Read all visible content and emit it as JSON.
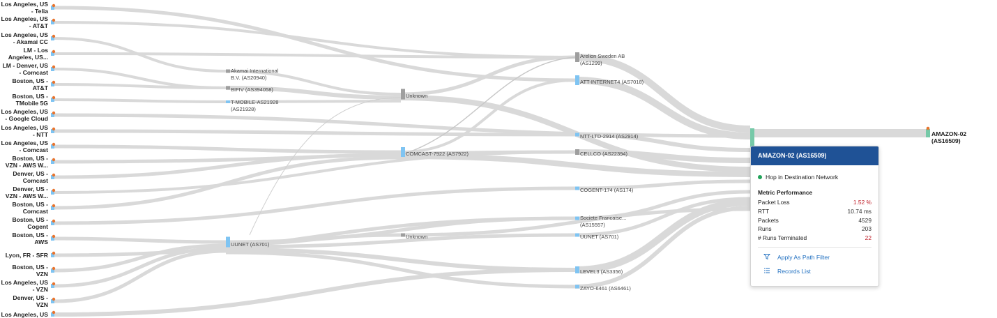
{
  "colors": {
    "flow": "#d9d9d9",
    "flow_thin": "#cfcfcf",
    "node_blue": "#7fc4f2",
    "node_gray": "#9e9e9e",
    "dest_green": "#76c9a8",
    "header_blue": "#1f5296",
    "loss_red": "#c0222c",
    "warn_orange": "#e8742e",
    "link_blue": "#1f6fc0"
  },
  "sources": [
    {
      "id": "s0",
      "label": "Los Angeles, US\n- Telia"
    },
    {
      "id": "s1",
      "label": "Los Angeles, US\n- AT&T"
    },
    {
      "id": "s2",
      "label": "Los Angeles, US\n- Akamai CC"
    },
    {
      "id": "s3",
      "label": "LM - Los\nAngeles, US..."
    },
    {
      "id": "s4",
      "label": "LM - Denver, US\n- Comcast"
    },
    {
      "id": "s5",
      "label": "Boston, US -\nAT&T"
    },
    {
      "id": "s6",
      "label": "Boston, US -\nTMobile 5G"
    },
    {
      "id": "s7",
      "label": "Los Angeles, US\n- Google Cloud"
    },
    {
      "id": "s8",
      "label": "Los Angeles, US\n- NTT"
    },
    {
      "id": "s9",
      "label": "Los Angeles, US\n- Comcast"
    },
    {
      "id": "s10",
      "label": "Boston, US -\nVZN - AWS W..."
    },
    {
      "id": "s11",
      "label": "Denver, US -\nComcast"
    },
    {
      "id": "s12",
      "label": "Denver, US -\nVZN - AWS W..."
    },
    {
      "id": "s13",
      "label": "Boston, US -\nComcast"
    },
    {
      "id": "s14",
      "label": "Boston, US -\nCogent"
    },
    {
      "id": "s15",
      "label": "Boston, US -\nAWS"
    },
    {
      "id": "s16",
      "label": "Lyon, FR - SFR"
    },
    {
      "id": "s17",
      "label": "Boston, US -\nVZN"
    },
    {
      "id": "s18",
      "label": "Los Angeles, US\n- VZN"
    },
    {
      "id": "s19",
      "label": "Denver, US -\nVZN"
    },
    {
      "id": "s20",
      "label": "Los Angeles, US"
    }
  ],
  "hop1_nodes": [
    {
      "id": "akamai",
      "label1": "Akamai International",
      "label2": "B.V. (AS20940)",
      "color": "gray"
    },
    {
      "id": "bifiv",
      "label1": "BIFIV (AS394058)",
      "label2": "",
      "color": "gray"
    },
    {
      "id": "tmobile",
      "label1": "T-MOBILE-AS21928",
      "label2": "(AS21928)",
      "color": "blue"
    },
    {
      "id": "uunet1",
      "label1": "UUNET (AS701)",
      "label2": "",
      "color": "blue"
    }
  ],
  "hop2_nodes": [
    {
      "id": "unknown1",
      "label1": "Unknown",
      "label2": "",
      "color": "gray"
    },
    {
      "id": "comcast",
      "label1": "COMCAST-7922 (AS7922)",
      "label2": "",
      "color": "blue"
    },
    {
      "id": "unknown2",
      "label1": "Unknown",
      "label2": "",
      "color": "gray"
    }
  ],
  "hop3_nodes": [
    {
      "id": "arelion",
      "label1": "Arelion Sweden AB",
      "label2": "(AS1299)",
      "color": "gray"
    },
    {
      "id": "att",
      "label1": "ATT-INTERNET4 (AS7018)",
      "label2": "",
      "color": "blue"
    },
    {
      "id": "ntt",
      "label1": "NTT-LTD-2914 (AS2914)",
      "label2": "",
      "color": "blue"
    },
    {
      "id": "cello",
      "label1": "CELLCO (AS22394)",
      "label2": "",
      "color": "gray"
    },
    {
      "id": "cogent",
      "label1": "COGENT-174 (AS174)",
      "label2": "",
      "color": "blue"
    },
    {
      "id": "sfr",
      "label1": "Societe Francaise...",
      "label2": "(AS15557)",
      "color": "blue"
    },
    {
      "id": "uunet2",
      "label1": "UUNET (AS701)",
      "label2": "",
      "color": "blue"
    },
    {
      "id": "level3",
      "label1": "LEVEL3 (AS3356)",
      "label2": "",
      "color": "blue"
    },
    {
      "id": "zayo",
      "label1": "ZAYO-6461 (AS6461)",
      "label2": "",
      "color": "blue"
    }
  ],
  "destination": {
    "label": "AMAZON-02 (AS16509)"
  },
  "popup": {
    "title": "AMAZON-02 (AS16509)",
    "hop_type": "Hop in Destination Network",
    "metrics_title": "Metric Performance",
    "metrics": [
      {
        "name": "Packet Loss",
        "value": "1.52 %",
        "red": true
      },
      {
        "name": "RTT",
        "value": "10.74 ms",
        "red": false
      },
      {
        "name": "Packets",
        "value": "4529",
        "red": false
      },
      {
        "name": "Runs",
        "value": "203",
        "red": false
      },
      {
        "name": "# Runs Terminated",
        "value": "22",
        "red": true
      }
    ],
    "actions": [
      {
        "label": "Apply As Path Filter",
        "icon": "filter-icon"
      },
      {
        "label": "Records List",
        "icon": "list-icon"
      }
    ]
  }
}
